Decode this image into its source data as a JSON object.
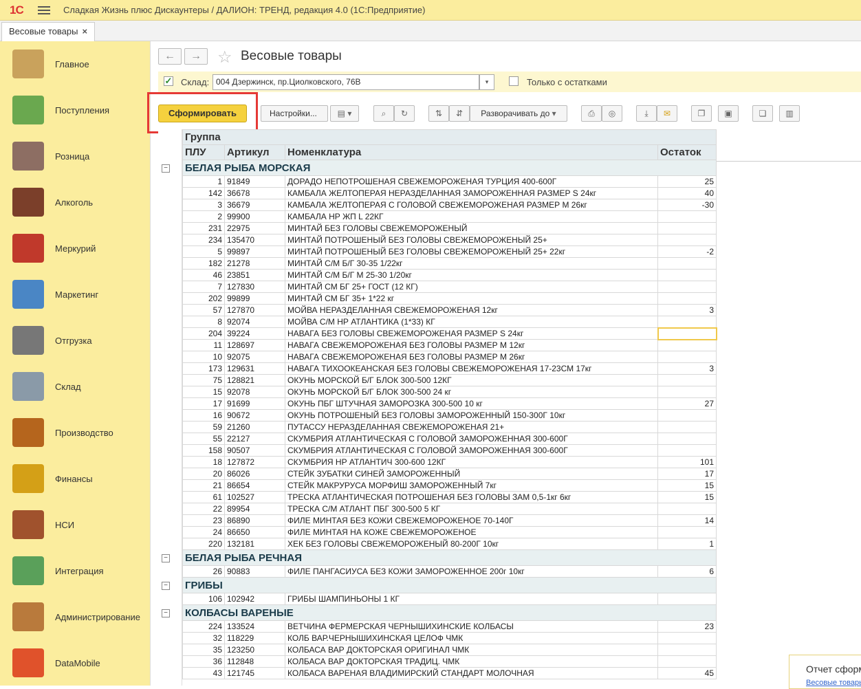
{
  "app": {
    "logo": "1С",
    "title": "Сладкая Жизнь плюс Дискаунтеры / ДАЛИОН: ТРЕНД, редакция 4.0  (1С:Предприятие)"
  },
  "tab": {
    "label": "Весовые товары",
    "close": "×"
  },
  "sidebar": {
    "items": [
      {
        "label": "Главное",
        "icon": "desk-lamp-icon",
        "color": "#c9a25c"
      },
      {
        "label": "Поступления",
        "icon": "cash-plus-icon",
        "color": "#6aa84f"
      },
      {
        "label": "Розница",
        "icon": "shopping-cart-icon",
        "color": "#8d6e63"
      },
      {
        "label": "Алкоголь",
        "icon": "wine-bottles-icon",
        "color": "#7b3f2a"
      },
      {
        "label": "Меркурий",
        "icon": "cube-icon",
        "color": "#c0392b"
      },
      {
        "label": "Маркетинг",
        "icon": "chart-icon",
        "color": "#4a86c5"
      },
      {
        "label": "Отгрузка",
        "icon": "forklift-icon",
        "color": "#777"
      },
      {
        "label": "Склад",
        "icon": "warehouse-icon",
        "color": "#8a9aa8"
      },
      {
        "label": "Производство",
        "icon": "roast-chicken-icon",
        "color": "#b5651d"
      },
      {
        "label": "Финансы",
        "icon": "coins-icon",
        "color": "#d4a017"
      },
      {
        "label": "НСИ",
        "icon": "books-icon",
        "color": "#a0522d"
      },
      {
        "label": "Интеграция",
        "icon": "arrows-exchange-icon",
        "color": "#5aa05a"
      },
      {
        "label": "Администрирование",
        "icon": "laptop-gear-icon",
        "color": "#b97a3c"
      },
      {
        "label": "DataMobile",
        "icon": "datamobile-icon",
        "color": "#e0522b"
      }
    ]
  },
  "form": {
    "title": "Весовые товары",
    "back": "←",
    "forward": "→",
    "star": "☆",
    "sklad_label": "Склад:",
    "sklad_value": "004 Дзержинск, пр.Циолковского, 76В",
    "only_rest_label": "Только с остатками",
    "check": "✓",
    "generate": "Сформировать",
    "settings": "Настройки...",
    "expand_to": "Разворачивать до",
    "dd": "▾"
  },
  "report": {
    "header_group": "Группа",
    "headers": [
      "ПЛУ",
      "Артикул",
      "Номенклатура",
      "Остаток"
    ],
    "groups": [
      {
        "name": "БЕЛАЯ РЫБА МОРСКАЯ",
        "rows": [
          [
            "1",
            "91849",
            "ДОРАДО НЕПОТРОШЕНАЯ СВЕЖЕМОРОЖЕНАЯ ТУРЦИЯ 400-600Г",
            "25"
          ],
          [
            "142",
            "36678",
            "КАМБАЛА ЖЕЛТОПЕРАЯ НЕРАЗДЕЛАННАЯ ЗАМОРОЖЕННАЯ РАЗМЕР S 24кг",
            "40"
          ],
          [
            "3",
            "36679",
            "КАМБАЛА ЖЕЛТОПЕРАЯ С ГОЛОВОЙ СВЕЖЕМОРОЖЕНАЯ РАЗМЕР М 26кг",
            "-30"
          ],
          [
            "2",
            "99900",
            "КАМБАЛА НР ЖП L 22КГ",
            ""
          ],
          [
            "231",
            "22975",
            "МИНТАЙ БЕЗ ГОЛОВЫ СВЕЖЕМОРОЖЕНЫЙ",
            ""
          ],
          [
            "234",
            "135470",
            "МИНТАЙ ПОТРОШЕНЫЙ БЕЗ ГОЛОВЫ СВЕЖЕМОРОЖЕНЫЙ 25+",
            ""
          ],
          [
            "5",
            "99897",
            "МИНТАЙ ПОТРОШЕНЫЙ БЕЗ ГОЛОВЫ СВЕЖЕМОРОЖЕНЫЙ 25+ 22кг",
            "-2"
          ],
          [
            "182",
            "21278",
            "МИНТАЙ С/М Б/Г 30-35 1/22кг",
            ""
          ],
          [
            "46",
            "23851",
            "МИНТАЙ С/М Б/Г М 25-30 1/20кг",
            ""
          ],
          [
            "7",
            "127830",
            "МИНТАЙ СМ БГ 25+ ГОСТ (12 КГ)",
            ""
          ],
          [
            "202",
            "99899",
            "МИНТАЙ СМ БГ 35+ 1*22 кг",
            ""
          ],
          [
            "57",
            "127870",
            "МОЙВА НЕРАЗДЕЛАННАЯ СВЕЖЕМОРОЖЕНАЯ 12кг",
            "3"
          ],
          [
            "8",
            "92074",
            "МОЙВА С/М НР АТЛАНТИКА (1*33) КГ",
            ""
          ],
          [
            "204",
            "39224",
            "НАВАГА БЕЗ ГОЛОВЫ СВЕЖЕМОРОЖЕНАЯ РАЗМЕР S 24кг",
            ""
          ],
          [
            "11",
            "128697",
            "НАВАГА СВЕЖЕМОРОЖЕНАЯ БЕЗ ГОЛОВЫ РАЗМЕР М 12кг",
            ""
          ],
          [
            "10",
            "92075",
            "НАВАГА СВЕЖЕМОРОЖЕНАЯ БЕЗ ГОЛОВЫ РАЗМЕР М 26кг",
            ""
          ],
          [
            "173",
            "129631",
            "НАВАГА ТИХООКЕАНСКАЯ БЕЗ ГОЛОВЫ СВЕЖЕМОРОЖЕНАЯ 17-23СМ 17кг",
            "3"
          ],
          [
            "75",
            "128821",
            "ОКУНЬ МОРСКОЙ Б/Г БЛОК 300-500 12КГ",
            ""
          ],
          [
            "15",
            "92078",
            "ОКУНЬ МОРСКОЙ Б/Г БЛОК 300-500 24 кг",
            ""
          ],
          [
            "17",
            "91699",
            "ОКУНЬ ПБГ ШТУЧНАЯ ЗАМОРОЗКА 300-500 10 кг",
            "27"
          ],
          [
            "16",
            "90672",
            "ОКУНЬ ПОТРОШЕНЫЙ БЕЗ ГОЛОВЫ ЗАМОРОЖЕННЫЙ 150-300Г 10кг",
            ""
          ],
          [
            "59",
            "21260",
            "ПУТАССУ НЕРАЗДЕЛАННАЯ СВЕЖЕМОРОЖЕНАЯ 21+",
            ""
          ],
          [
            "55",
            "22127",
            "СКУМБРИЯ АТЛАНТИЧЕСКАЯ С ГОЛОВОЙ ЗАМОРОЖЕННАЯ 300-600Г",
            ""
          ],
          [
            "158",
            "90507",
            "СКУМБРИЯ АТЛАНТИЧЕСКАЯ С ГОЛОВОЙ ЗАМОРОЖЕННАЯ 300-600Г",
            ""
          ],
          [
            "18",
            "127872",
            "СКУМБРИЯ НР АТЛАНТИЧ 300-600 12КГ",
            "101"
          ],
          [
            "20",
            "86026",
            "СТЕЙК ЗУБАТКИ СИНЕЙ ЗАМОРОЖЕННЫЙ",
            "17"
          ],
          [
            "21",
            "86654",
            "СТЕЙК МАКРУРУСА МОРФИШ ЗАМОРОЖЕННЫЙ 7кг",
            "15"
          ],
          [
            "61",
            "102527",
            "ТРЕСКА АТЛАНТИЧЕСКАЯ ПОТРОШЕНАЯ БЕЗ ГОЛОВЫ ЗАМ 0,5-1кг 6кг",
            "15"
          ],
          [
            "22",
            "89954",
            "ТРЕСКА С/М АТЛАНТ ПБГ 300-500 5 КГ",
            ""
          ],
          [
            "23",
            "86890",
            "ФИЛЕ МИНТАЯ БЕЗ КОЖИ СВЕЖЕМОРОЖЕНОЕ 70-140Г",
            "14"
          ],
          [
            "24",
            "86650",
            "ФИЛЕ МИНТАЯ НА КОЖЕ СВЕЖЕМОРОЖЕНОЕ",
            ""
          ],
          [
            "220",
            "132181",
            "ХЕК БЕЗ ГОЛОВЫ СВЕЖЕМОРОЖЕНЫЙ 80-200Г 10кг",
            "1"
          ]
        ]
      },
      {
        "name": "БЕЛАЯ РЫБА РЕЧНАЯ",
        "rows": [
          [
            "26",
            "90883",
            "ФИЛЕ ПАНГАСИУСА БЕЗ КОЖИ ЗАМОРОЖЕННОЕ 200г 10кг",
            "6"
          ]
        ]
      },
      {
        "name": "ГРИБЫ",
        "rows": [
          [
            "106",
            "102942",
            "ГРИБЫ ШАМПИНЬОНЫ 1 КГ",
            ""
          ]
        ]
      },
      {
        "name": "КОЛБАСЫ ВАРЕНЫЕ",
        "rows": [
          [
            "224",
            "133524",
            "ВЕТЧИНА ФЕРМЕРСКАЯ ЧЕРНЫШИХИНСКИЕ КОЛБАСЫ",
            "23"
          ],
          [
            "32",
            "118229",
            "КОЛБ ВАР.ЧЕРНЫШИХИНСКАЯ ЦЕЛОФ ЧМК",
            ""
          ],
          [
            "35",
            "123250",
            "КОЛБАСА ВАР ДОКТОРСКАЯ ОРИГИНАЛ ЧМК",
            ""
          ],
          [
            "36",
            "112848",
            "КОЛБАСА ВАР ДОКТОРСКАЯ ТРАДИЦ. ЧМК",
            ""
          ],
          [
            "43",
            "121745",
            "КОЛБАСА ВАРЕНАЯ ВЛАДИМИРСКИЙ СТАНДАРТ МОЛОЧНАЯ",
            "45"
          ]
        ]
      }
    ]
  },
  "popup": {
    "title": "Отчет сформирован",
    "sub": "Весовые товары"
  }
}
